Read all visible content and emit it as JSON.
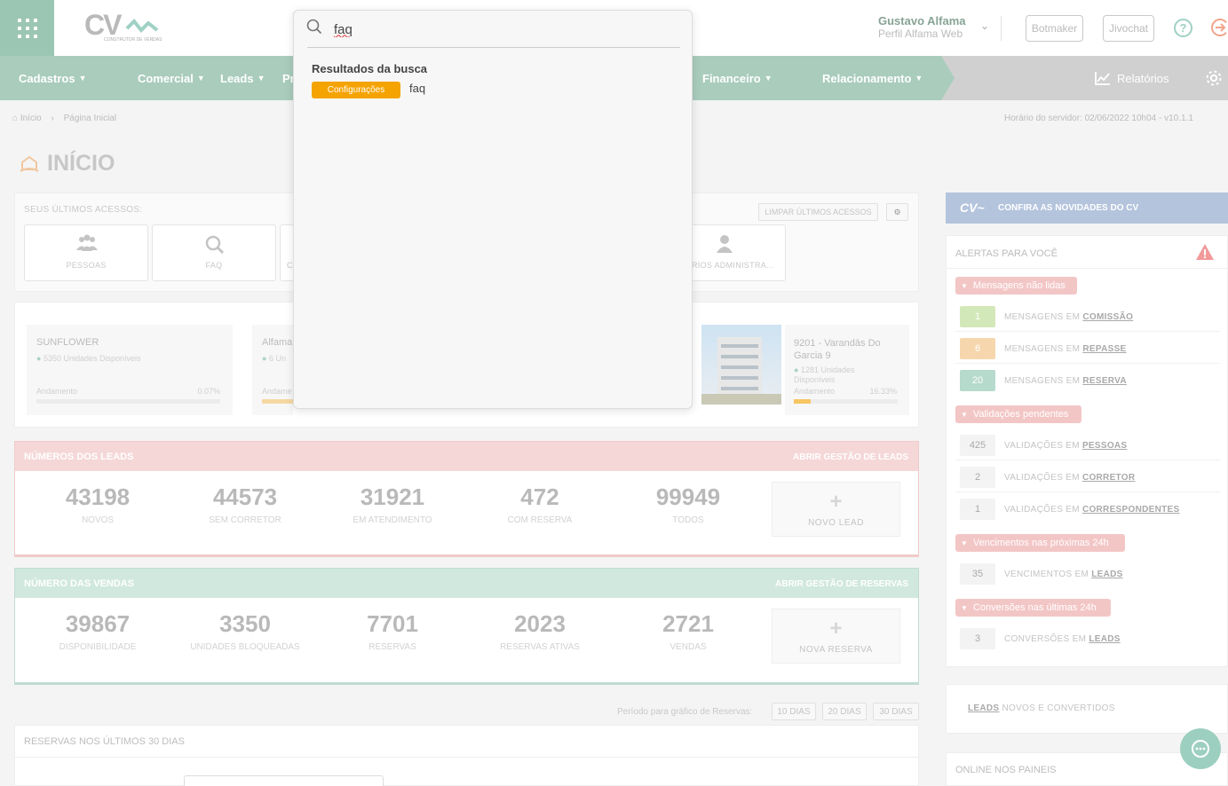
{
  "header": {
    "user_name": "Gustavo Alfama",
    "user_profile": "Perfil Alfama Web",
    "botmaker": "Botmaker",
    "jivochat": "Jivochat",
    "logo_text": "CV",
    "logo_sub": "CONSTRUTOR DE VENDAS"
  },
  "nav": {
    "items": [
      {
        "label": "Cadastros"
      },
      {
        "label": "Comercial"
      },
      {
        "label": "Leads"
      },
      {
        "label": "Pr"
      },
      {
        "label": "Financeiro"
      },
      {
        "label": "Relacionamento"
      }
    ],
    "reports": "Relatórios"
  },
  "breadcrumb": {
    "home": "Início",
    "current": "Página Inicial",
    "server_time": "Horário do servidor: 02/06/2022 10h04 - v10.1.1"
  },
  "page": {
    "title": "INÍCIO"
  },
  "recent": {
    "title": "SEUS ÚLTIMOS ACESSOS:",
    "clear": "LIMPAR ÚLTIMOS ACESSOS",
    "items": [
      {
        "label": "PESSOAS",
        "icon": "people-icon"
      },
      {
        "label": "FAQ",
        "icon": "search-icon"
      },
      {
        "label": "C",
        "icon": ""
      },
      {
        "label": "RIOS ADMINISTRA...",
        "icon": "user-icon"
      }
    ]
  },
  "projects": [
    {
      "name": "SUNFLOWER",
      "units": "5350 Unidades Disponíveis",
      "progress_label": "Andamento",
      "progress": "0.07%"
    },
    {
      "name": "Alfama",
      "units": "6 Un",
      "progress_label": "Andame",
      "progress": ""
    },
    {
      "name": "9201 - Varandās Do Garcia 9",
      "units": "1281 Unidades Disponíveis",
      "progress_label": "Andamento",
      "progress": "16.33%"
    }
  ],
  "leads": {
    "title": "NÚMEROS DOS LEADS",
    "link": "ABRIR GESTÃO DE LEADS",
    "stats": [
      {
        "value": "43198",
        "label": "NOVOS"
      },
      {
        "value": "44573",
        "label": "SEM CORRETOR"
      },
      {
        "value": "31921",
        "label": "EM ATENDIMENTO"
      },
      {
        "value": "472",
        "label": "COM RESERVA"
      },
      {
        "value": "99949",
        "label": "TODOS"
      }
    ],
    "new": "NOVO LEAD"
  },
  "sales": {
    "title": "NÚMERO DAS VENDAS",
    "link": "ABRIR GESTÃO DE RESERVAS",
    "stats": [
      {
        "value": "39867",
        "label": "DISPONIBILIDADE"
      },
      {
        "value": "3350",
        "label": "UNIDADES BLOQUEADAS"
      },
      {
        "value": "7701",
        "label": "RESERVAS"
      },
      {
        "value": "2023",
        "label": "RESERVAS ATIVAS"
      },
      {
        "value": "2721",
        "label": "VENDAS"
      }
    ],
    "new": "NOVA RESERVA"
  },
  "period": {
    "label": "Período para gráfico de Reservas:",
    "options": [
      "10 DIAS",
      "20 DIAS",
      "30 DIAS"
    ]
  },
  "reservations_chart": {
    "title": "RESERVAS NOS ÚLTIMOS 30 DIAS"
  },
  "right": {
    "news": "CONFIRA AS NOVIDADES DO CV",
    "alerts_title": "ALERTAS PARA VOCÊ",
    "groups": [
      {
        "title": "Mensagens não lidas",
        "rows": [
          {
            "num": "1",
            "text": "MENSAGENS EM ",
            "link": "COMISSÃO",
            "color": "#c9e2a9"
          },
          {
            "num": "6",
            "text": "MENSAGENS EM ",
            "link": "REPASSE",
            "color": "#f4c98e"
          },
          {
            "num": "20",
            "text": "MENSAGENS EM ",
            "link": "RESERVA",
            "color": "#a8d3c4"
          }
        ]
      },
      {
        "title": "Validações pendentes",
        "rows": [
          {
            "num": "425",
            "text": "VALIDAÇÕES EM ",
            "link": "PESSOAS",
            "color": "#f0f0f0"
          },
          {
            "num": "2",
            "text": "VALIDAÇÕES EM ",
            "link": "CORRETOR",
            "color": "#f0f0f0"
          },
          {
            "num": "1",
            "text": "VALIDAÇÕES EM ",
            "link": "CORRESPONDENTES",
            "color": "#f0f0f0"
          }
        ]
      },
      {
        "title": "Vencimentos nas próximas 24h",
        "rows": [
          {
            "num": "35",
            "text": "VENCIMENTOS EM ",
            "link": "LEADS",
            "color": "#f0f0f0"
          }
        ]
      },
      {
        "title": "Conversões nas últimas 24h",
        "rows": [
          {
            "num": "3",
            "text": "CONVERSÕES EM ",
            "link": "LEADS",
            "color": "#f0f0f0"
          }
        ]
      }
    ],
    "leads_conv_link": "LEADS",
    "leads_conv_text": " NOVOS E CONVERTIDOS",
    "online": "ONLINE NOS PAINEIS"
  },
  "search": {
    "query": "faq",
    "results_title": "Resultados da busca",
    "result_badge": "Configurações",
    "result_text": "faq"
  }
}
